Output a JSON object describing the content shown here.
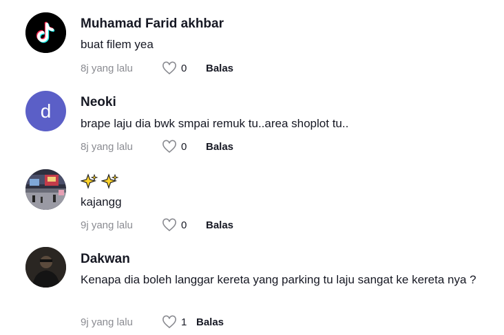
{
  "comments": [
    {
      "name": "Muhamad Farid akhbar",
      "text": "buat filem yea",
      "time": "8j yang lalu",
      "likes": "0",
      "reply": "Balas",
      "avatar_icon": "tiktok-logo-icon"
    },
    {
      "name": "Neoki",
      "text": "brape laju dia bwk smpai remuk tu..area shoplot tu..",
      "time": "8j yang lalu",
      "likes": "0",
      "reply": "Balas",
      "avatar_letter": "d",
      "avatar_color": "#5b5fc7"
    },
    {
      "name_icon": "sparkles-icon",
      "text": "kajangg",
      "time": "9j yang lalu",
      "likes": "0",
      "reply": "Balas"
    },
    {
      "name": "Dakwan",
      "text": "Kenapa dia boleh langgar kereta yang parking tu laju sangat ke kereta nya ?",
      "time": "9j yang lalu",
      "likes": "1",
      "reply": "Balas"
    }
  ]
}
